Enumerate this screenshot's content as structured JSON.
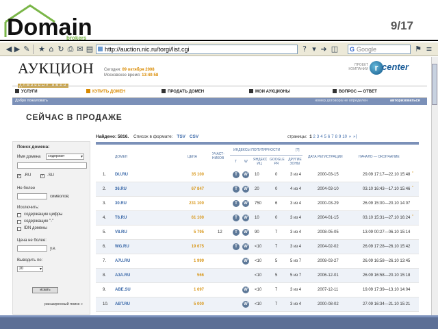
{
  "slide": {
    "logo_text": "Domain",
    "logo_sub": "brokers",
    "page_number": "9/17"
  },
  "browser": {
    "url": "http://auction.nic.ru/torgi/list.cgi",
    "search_placeholder": "Google"
  },
  "site": {
    "logo_main": "АУКЦИОН",
    "logo_sub": "доменных имен",
    "date_label": "Сегодня:",
    "date_value": "09 октября 2008",
    "time_label": "Московское время:",
    "time_value": "13:40:58",
    "partner_label": "ПРОЕКТ КОМПАНИИ",
    "partner_logo": "center",
    "partner_logo_letter": "r"
  },
  "nav": [
    {
      "label": "УСЛУГИ",
      "active": false
    },
    {
      "label": "КУПИТЬ ДОМЕН",
      "active": true
    },
    {
      "label": "ПРОДАТЬ ДОМЕН",
      "active": false
    },
    {
      "label": "МОИ АУКЦИОНЫ",
      "active": false
    },
    {
      "label": "ВОПРОС — ОТВЕТ",
      "active": false
    }
  ],
  "subbar": {
    "welcome": "Добро пожаловать",
    "contract": "номер договора не определен",
    "login": "авторизоваться"
  },
  "heading": "СЕЙЧАС В ПРОДАЖЕ",
  "search_panel": {
    "title": "Поиск домена:",
    "name_label": "Имя домена",
    "match_option": "содержит",
    "zone_ru": ".RU",
    "zone_su": ".SU",
    "max_label": "Не более",
    "chars_label": "символов;",
    "exclude_label": "Исключить:",
    "exclude_digits": "содержащие цифры",
    "exclude_dash": "содержащие \"-\"",
    "exclude_idn": "IDN домены",
    "price_label": "Цена не более:",
    "currency": "у.е.",
    "show_label": "Выводить по:",
    "per_page": "20",
    "search_button": "искать",
    "advanced_link": "расширенный поиск »"
  },
  "results": {
    "found_label": "Найдено:",
    "found_count": "5816.",
    "format_label": "Список в формате:",
    "format_tsv": "TSV",
    "format_csv": "CSV",
    "pages_label": "страницы:",
    "pages": [
      "1",
      "2",
      "3",
      "4",
      "5",
      "6",
      "7",
      "8",
      "9",
      "10"
    ],
    "current_page": "1",
    "next_arrow": "»",
    "last_arrow": "»|",
    "headers": {
      "domain": "ДОМЕН",
      "price": "ЦЕНА",
      "participants": "УЧАСТ-НИКОВ",
      "popularity": "ИНДЕКСЫ ПОПУЛЯРНОСТИ",
      "popularity_hint": "[?]",
      "t": "Т",
      "w": "W",
      "yandex": "Яндекс ИЦ",
      "google": "Google PR",
      "other_zones": "ДРУГИЕ ЗОНЫ",
      "reg_date": "ДАТА РЕГИСТРАЦИИ",
      "start_end": "НАЧАЛО — ОКОНЧАНИЕ"
    },
    "rows": [
      {
        "n": "1.",
        "domain": "DU.RU",
        "price": "35 100",
        "participants": "",
        "t": "T",
        "w": "W",
        "yandex": "10",
        "google": "0",
        "zones": "3 из 4",
        "reg": "2000-03-15",
        "period": "29.09 17:17—22.10 15:48",
        "new": "*"
      },
      {
        "n": "2.",
        "domain": "36.RU",
        "price": "67 847",
        "participants": "",
        "t": "T",
        "w": "W",
        "yandex": "20",
        "google": "0",
        "zones": "4 из 4",
        "reg": "2004-03-10",
        "period": "03.10 16:43—17.10 15:46",
        "new": "*"
      },
      {
        "n": "3.",
        "domain": "30.RU",
        "price": "231 100",
        "participants": "",
        "t": "T",
        "w": "W",
        "yandex": "750",
        "google": "6",
        "zones": "3 из 4",
        "reg": "2000-03-29",
        "period": "26.09 15:00—20.10 14:07",
        "new": ""
      },
      {
        "n": "4.",
        "domain": "T6.RU",
        "price": "61 100",
        "participants": "",
        "t": "T",
        "w": "W",
        "yandex": "10",
        "google": "0",
        "zones": "3 из 4",
        "reg": "2004-01-15",
        "period": "03.10 15:31—27.10 16:24",
        "new": "*"
      },
      {
        "n": "5.",
        "domain": "V8.RU",
        "price": "5 795",
        "participants": "12",
        "t": "T",
        "w": "W",
        "yandex": "90",
        "google": "7",
        "zones": "3 из 4",
        "reg": "2008-05-05",
        "period": "13.09 00:27—06.10 15:14",
        "new": ""
      },
      {
        "n": "6.",
        "domain": "WG.RU",
        "price": "19 675",
        "participants": "",
        "t": "T",
        "w": "W",
        "yandex": "<10",
        "google": "7",
        "zones": "3 из 4",
        "reg": "2004-02-02",
        "period": "26.09 17:28—26.10 15:42",
        "new": ""
      },
      {
        "n": "7.",
        "domain": "A7U.RU",
        "price": "1 999",
        "participants": "",
        "t": "",
        "w": "W",
        "yandex": "<10",
        "google": "5",
        "zones": "5 из 7",
        "reg": "2008-03-27",
        "period": "26.09 16:58—26.10 13:45",
        "new": ""
      },
      {
        "n": "8.",
        "domain": "A3A.RU",
        "price": "566",
        "participants": "",
        "t": "",
        "w": "",
        "yandex": "<10",
        "google": "5",
        "zones": "5 из 7",
        "reg": "2006-12-01",
        "period": "26.09 16:58—20.10 15:18",
        "new": ""
      },
      {
        "n": "9.",
        "domain": "ABE.SU",
        "price": "1 697",
        "participants": "",
        "t": "",
        "w": "W",
        "yandex": "<10",
        "google": "7",
        "zones": "3 из 4",
        "reg": "2007-12-11",
        "period": "19.09 17:39—13.10 14:04",
        "new": ""
      },
      {
        "n": "10.",
        "domain": "ABT.RU",
        "price": "5 000",
        "participants": "",
        "t": "",
        "w": "W",
        "yandex": "<10",
        "google": "7",
        "zones": "3 из 4",
        "reg": "2000-08-02",
        "period": "27.09 16:34—21.10 15:21",
        "new": ""
      }
    ]
  }
}
